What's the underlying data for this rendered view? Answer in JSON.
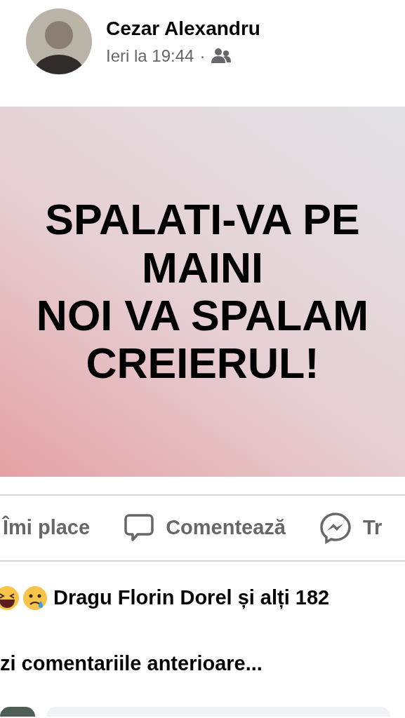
{
  "post": {
    "author": "Cezar Alexandru",
    "time": "Ieri la 19:44",
    "separator": "·",
    "audience": {
      "kind": "friends"
    },
    "image_text": [
      "SPALATI-VA PE",
      "MAINI",
      "NOI VA SPALAM",
      "CREIERUL!"
    ]
  },
  "actions": [
    {
      "kind": "like",
      "label": "Îmi place"
    },
    {
      "kind": "comment",
      "label": "Comentează"
    },
    {
      "kind": "share",
      "label": "Tr"
    }
  ],
  "reactions": {
    "icons": [
      {
        "kind": "haha"
      },
      {
        "kind": "sad"
      }
    ],
    "summary": "Dragu Florin Dorel și alți 182"
  },
  "comments": {
    "previous_link": "zi comentariile anterioare..."
  }
}
